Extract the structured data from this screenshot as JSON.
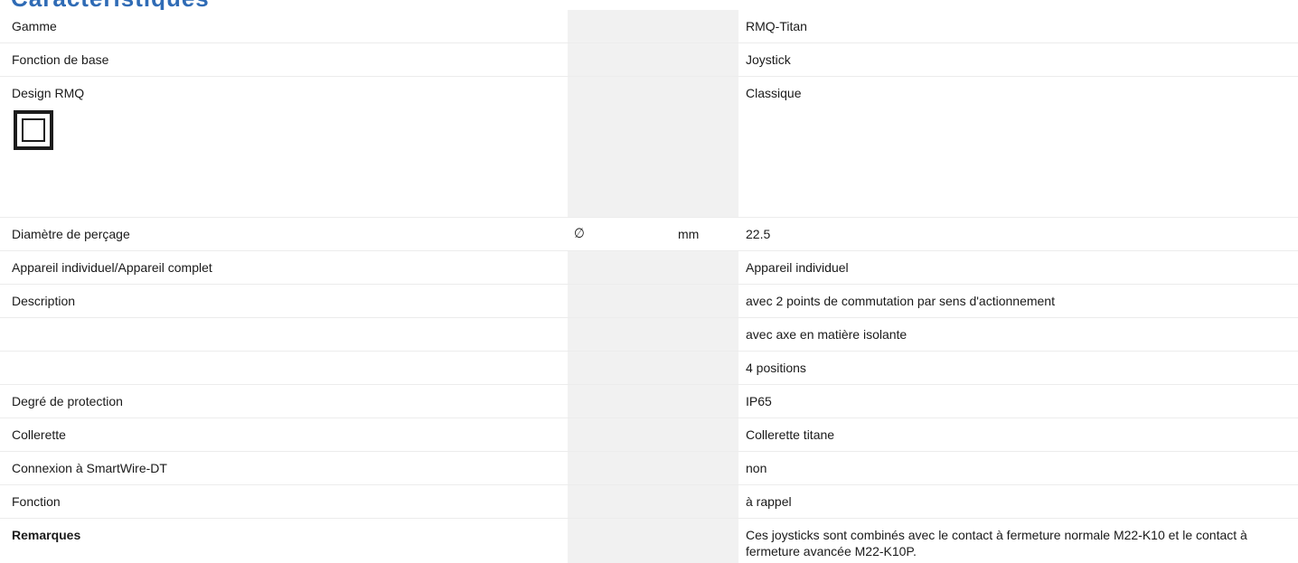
{
  "heading": "Caractéristiques",
  "rows": [
    {
      "label": "Gamme",
      "symbol": "",
      "unit": "",
      "value": "RMQ-Titan"
    },
    {
      "label": "Fonction de base",
      "symbol": "",
      "unit": "",
      "value": "Joystick"
    },
    {
      "label": "Design RMQ",
      "symbol": "",
      "unit": "",
      "value": "Classique",
      "icon": "rmq-classic-square-icon"
    },
    {
      "label": "Diamètre de perçage",
      "symbol": "∅",
      "unit": "mm",
      "value": "22.5"
    },
    {
      "label": "Appareil individuel/Appareil complet",
      "symbol": "",
      "unit": "",
      "value": "Appareil individuel"
    },
    {
      "label": "Description",
      "symbol": "",
      "unit": "",
      "value": "avec 2 points de commutation par sens d'actionnement"
    },
    {
      "label": "",
      "symbol": "",
      "unit": "",
      "value": "avec axe en matière isolante"
    },
    {
      "label": "",
      "symbol": "",
      "unit": "",
      "value": "4 positions"
    },
    {
      "label": "Degré de protection",
      "symbol": "",
      "unit": "",
      "value": "IP65"
    },
    {
      "label": "Collerette",
      "symbol": "",
      "unit": "",
      "value": "Collerette titane"
    },
    {
      "label": "Connexion à SmartWire-DT",
      "symbol": "",
      "unit": "",
      "value": "non"
    },
    {
      "label": "Fonction",
      "symbol": "",
      "unit": "",
      "value": "à rappel"
    },
    {
      "label": "Remarques",
      "symbol": "",
      "unit": "",
      "value": "Ces joysticks sont combinés avec le contact à fermeture normale M22-K10 et le contact à fermeture avancée M22-K10P."
    }
  ],
  "colors": {
    "heading": "#2f6bb5",
    "shaded_column": "#f1f1f1",
    "row_divider": "#ececec"
  }
}
